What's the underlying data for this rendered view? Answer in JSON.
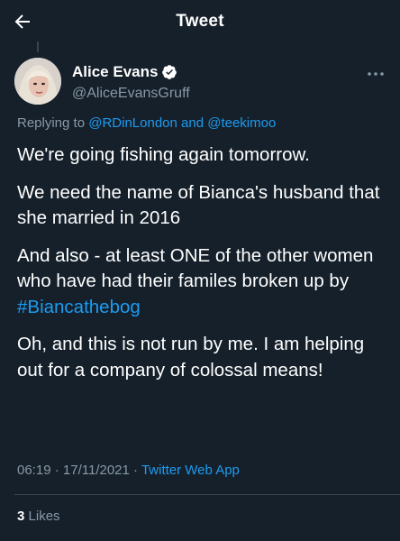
{
  "header": {
    "title": "Tweet",
    "back_icon": "back-arrow-icon"
  },
  "author": {
    "name": "Alice Evans",
    "handle": "@AliceEvansGruff",
    "verified": true,
    "verified_icon": "verified-badge-icon"
  },
  "reply": {
    "prefix": "Replying to",
    "user1": "@RDinLondon",
    "conj": "and",
    "user2": "@teekimoo"
  },
  "tweet": {
    "p1": "We're going fishing again tomorrow.",
    "p2": "We need the name of Bianca's husband that she married in 2016",
    "p3_text": "And also - at least ONE of the other women who have had their familes broken up by",
    "p3_hashtag": "#Biancathebog",
    "p4": "Oh, and this is not run by me. I am helping out for a company of colossal means!"
  },
  "meta": {
    "time": "06:19",
    "date": "17/11/2021",
    "separator": "·",
    "source": "Twitter Web App"
  },
  "stats": {
    "likes_count": "3",
    "likes_label": "Likes"
  },
  "colors": {
    "background": "#15202b",
    "accent": "#1d9bf0",
    "secondary_text": "#8899a6",
    "divider": "#38444d"
  }
}
